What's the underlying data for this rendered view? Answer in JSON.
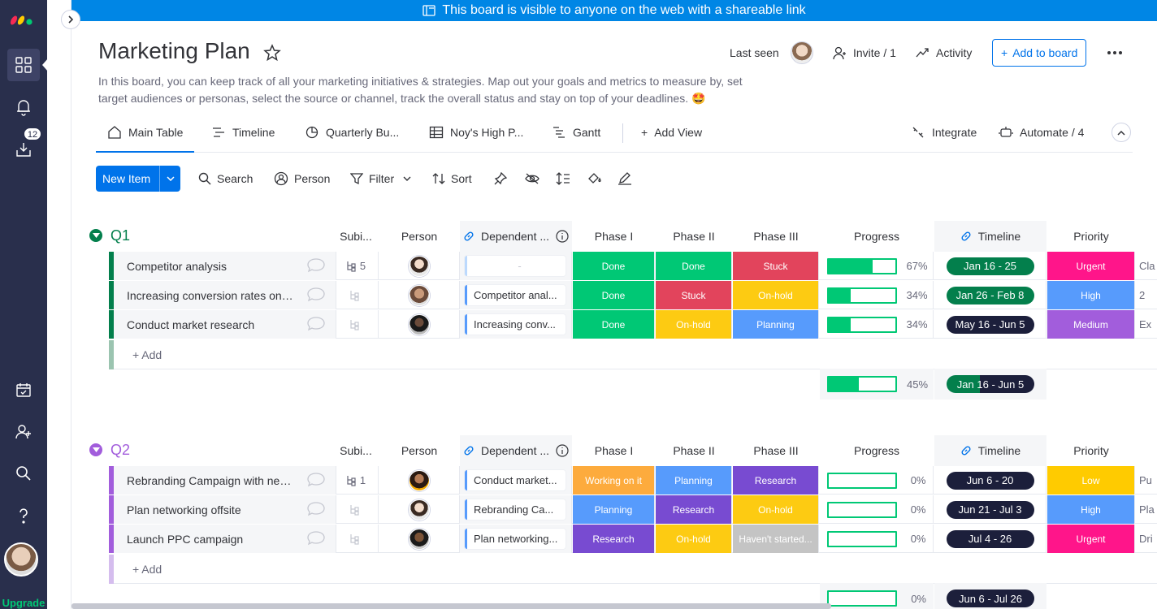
{
  "banner": {
    "text": "This board is visible to anyone on the web with a shareable link"
  },
  "rail": {
    "notification_count": "12",
    "upgrade_label": "Upgrade"
  },
  "header": {
    "title": "Marketing Plan",
    "last_seen_label": "Last seen",
    "invite_label": "Invite / 1",
    "activity_label": "Activity",
    "add_to_board_label": "Add to board",
    "description": "In this board, you can keep track of all your marketing initiatives & strategies. Map out your goals and metrics to measure by, set target audiences or personas, select the source or channel, track the overall status and stay on top of your deadlines. 🤩"
  },
  "tabs": {
    "main_table": "Main Table",
    "timeline": "Timeline",
    "quarterly": "Quarterly Bu...",
    "noys": "Noy's High P...",
    "gantt": "Gantt",
    "add_view": "Add View",
    "integrate": "Integrate",
    "automate": "Automate / 4"
  },
  "toolbar": {
    "new_item": "New Item",
    "search": "Search",
    "person": "Person",
    "filter": "Filter",
    "sort": "Sort"
  },
  "columns": {
    "subitems": "Subi...",
    "person": "Person",
    "dependent": "Dependent ...",
    "phase1": "Phase I",
    "phase2": "Phase II",
    "phase3": "Phase III",
    "progress": "Progress",
    "timeline": "Timeline",
    "priority": "Priority"
  },
  "colors": {
    "done": "#00c875",
    "stuck": "#e2445c",
    "onhold": "#fdcb12",
    "planning": "#579bfc",
    "working": "#fdab3d",
    "research": "#784bd1",
    "notstarted": "#c4c4c4",
    "urgent": "#ff158a",
    "high": "#579bfc",
    "medium": "#a25ddc",
    "low": "#ffcb00",
    "q1": "#037f4c",
    "q2": "#a25ddc",
    "timeline_green": "#037f4c",
    "timeline_dark": "#1c1f3b"
  },
  "add_label": "+ Add",
  "groups": [
    {
      "name": "Q1",
      "rows": [
        {
          "name": "Competitor analysis",
          "subitems": "5",
          "dependent": "-",
          "phase1": "Done",
          "phase2": "Done",
          "phase3": "Stuck",
          "progress": 67,
          "progress_label": "67%",
          "timeline": "Jan 16 - 25",
          "priority": "Urgent",
          "extra": "Cla"
        },
        {
          "name": "Increasing conversion rates on lan...",
          "subitems": "",
          "dependent": "Competitor anal...",
          "phase1": "Done",
          "phase2": "Stuck",
          "phase3": "On-hold",
          "progress": 34,
          "progress_label": "34%",
          "timeline": "Jan 26 - Feb 8",
          "priority": "High",
          "extra": "2"
        },
        {
          "name": "Conduct market research",
          "subitems": "",
          "dependent": "Increasing conv...",
          "phase1": "Done",
          "phase2": "On-hold",
          "phase3": "Planning",
          "progress": 34,
          "progress_label": "34%",
          "timeline": "May 16 - Jun 5",
          "priority": "Medium",
          "extra": "Ex"
        }
      ],
      "summary_progress": 45,
      "summary_progress_label": "45%",
      "summary_timeline": "Jan 16 - Jun 5"
    },
    {
      "name": "Q2",
      "rows": [
        {
          "name": "Rebranding Campaign with new lo...",
          "subitems": "1",
          "dependent": "Conduct market...",
          "phase1": "Working on it",
          "phase2": "Planning",
          "phase3": "Research",
          "progress": 0,
          "progress_label": "0%",
          "timeline": "Jun 6 - 20",
          "priority": "Low",
          "extra": "Pu"
        },
        {
          "name": "Plan networking offsite",
          "subitems": "",
          "dependent": "Rebranding Ca...",
          "phase1": "Planning",
          "phase2": "Research",
          "phase3": "On-hold",
          "progress": 0,
          "progress_label": "0%",
          "timeline": "Jun 21 - Jul 3",
          "priority": "High",
          "extra": "Pla"
        },
        {
          "name": "Launch PPC campaign",
          "subitems": "",
          "dependent": "Plan networking...",
          "phase1": "Research",
          "phase2": "On-hold",
          "phase3": "Haven't started...",
          "progress": 0,
          "progress_label": "0%",
          "timeline": "Jul 4 - 26",
          "priority": "Urgent",
          "extra": "Dri"
        }
      ],
      "summary_progress": 0,
      "summary_progress_label": "0%",
      "summary_timeline": "Jun 6 - Jul 26"
    }
  ]
}
